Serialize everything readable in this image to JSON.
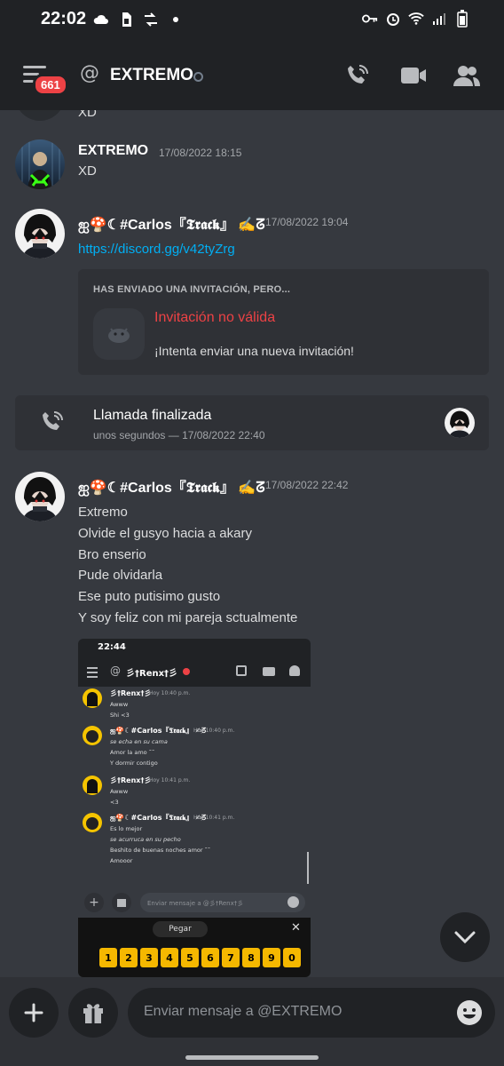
{
  "status_bar": {
    "time": "22:02"
  },
  "header": {
    "badge_count": "661",
    "channel_name": "EXTREMO"
  },
  "messages": {
    "prev_text": "XD",
    "m1": {
      "user": "EXTREMO",
      "ts": "17/08/2022 18:15",
      "text": "XD"
    },
    "m2": {
      "user": "ஐ🍄☾#Carlos『𝕿𝖗𝖆𝖈𝖐』 ✍ᘔ",
      "ts": "17/08/2022 19:04",
      "link": "https://discord.gg/v42tyZrg",
      "invite_header": "HAS ENVIADO UNA INVITACIÓN, PERO...",
      "invite_invalid": "Invitación no válida",
      "invite_sub": "¡Intenta enviar una nueva invitación!"
    },
    "call": {
      "title": "Llamada finalizada",
      "sub": "unos segundos — 17/08/2022 22:40"
    },
    "m3": {
      "user": "ஐ🍄☾#Carlos『𝕿𝖗𝖆𝖈𝖐』 ✍ᘔ",
      "ts": "17/08/2022 22:42",
      "lines": [
        "Extremo",
        "Olvide el gusyo hacia a akary",
        "Bro  enserio",
        "Pude olvidarla",
        "Ese puto putisimo gusto",
        "Y soy feliz con mi pareja sctualmente"
      ]
    }
  },
  "attachment": {
    "time": "22:44",
    "channel": "彡†Renx†彡",
    "posts": [
      {
        "user": "彡†Renx†彡",
        "ts": "Hoy 10:40 p.m.",
        "lines": [
          "Awww",
          "Shi <3"
        ]
      },
      {
        "user": "ஐ🍄☾#Carlos『𝕿𝖗𝖆𝖈𝖐』 ✍ᘔ",
        "ts": "Hoy 10:40 p.m.",
        "lines": [
          "se echa en su cama",
          "Amor la amo ˘˘",
          "Y dormir contigo"
        ]
      },
      {
        "user": "彡†Renx†彡",
        "ts": "Hoy 10:41 p.m.",
        "lines": [
          "Awww",
          "<3"
        ]
      },
      {
        "user": "ஐ🍄☾#Carlos『𝕿𝖗𝖆𝖈𝖐』 ✍ᘔ",
        "ts": "Hoy 10:41 p.m.",
        "lines": [
          "Es lo mejor",
          "se acurruca en su pecho",
          "Beshito de buenas noches amor ˘˘",
          "Amooor"
        ]
      }
    ],
    "input_placeholder": "Enviar mensaje a @彡†Renx†彡",
    "paste_label": "Pegar",
    "keys": [
      "1",
      "2",
      "3",
      "4",
      "5",
      "6",
      "7",
      "8",
      "9",
      "0"
    ]
  },
  "composer": {
    "placeholder": "Enviar mensaje a @EXTREMO"
  },
  "colors": {
    "background": "#36393f",
    "header": "#202225",
    "link": "#00aff4",
    "error": "#ed4245"
  }
}
